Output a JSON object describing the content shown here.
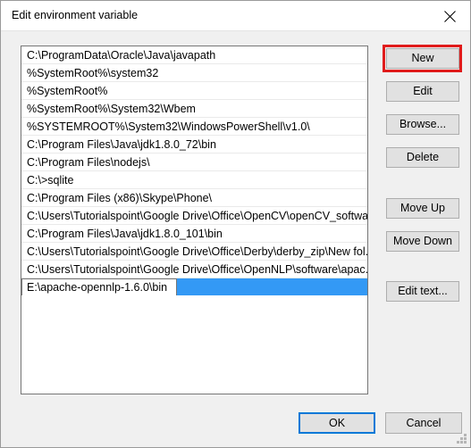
{
  "window": {
    "title": "Edit environment variable",
    "close_icon": "close-icon"
  },
  "path_list": {
    "entries": [
      "C:\\ProgramData\\Oracle\\Java\\javapath",
      "%SystemRoot%\\system32",
      "%SystemRoot%",
      "%SystemRoot%\\System32\\Wbem",
      "%SYSTEMROOT%\\System32\\WindowsPowerShell\\v1.0\\",
      "C:\\Program Files\\Java\\jdk1.8.0_72\\bin",
      "C:\\Program Files\\nodejs\\",
      "C:\\>sqlite",
      "C:\\Program Files (x86)\\Skype\\Phone\\",
      "C:\\Users\\Tutorialspoint\\Google Drive\\Office\\OpenCV\\openCV_softwa...",
      "C:\\Program Files\\Java\\jdk1.8.0_101\\bin",
      "C:\\Users\\Tutorialspoint\\Google Drive\\Office\\Derby\\derby_zip\\New fol...",
      "C:\\Users\\Tutorialspoint\\Google Drive\\Office\\OpenNLP\\software\\apac..."
    ],
    "editing_value": "E:\\apache-opennlp-1.6.0\\bin",
    "selection_color": "#3399f5"
  },
  "side_buttons": {
    "new": "New",
    "edit": "Edit",
    "browse": "Browse...",
    "delete": "Delete",
    "move_up": "Move Up",
    "move_down": "Move Down",
    "edit_text": "Edit text..."
  },
  "highlight": {
    "target": "New",
    "color": "#e01b1b"
  },
  "bottom_buttons": {
    "ok": "OK",
    "cancel": "Cancel",
    "focus_color": "#0078d7"
  }
}
